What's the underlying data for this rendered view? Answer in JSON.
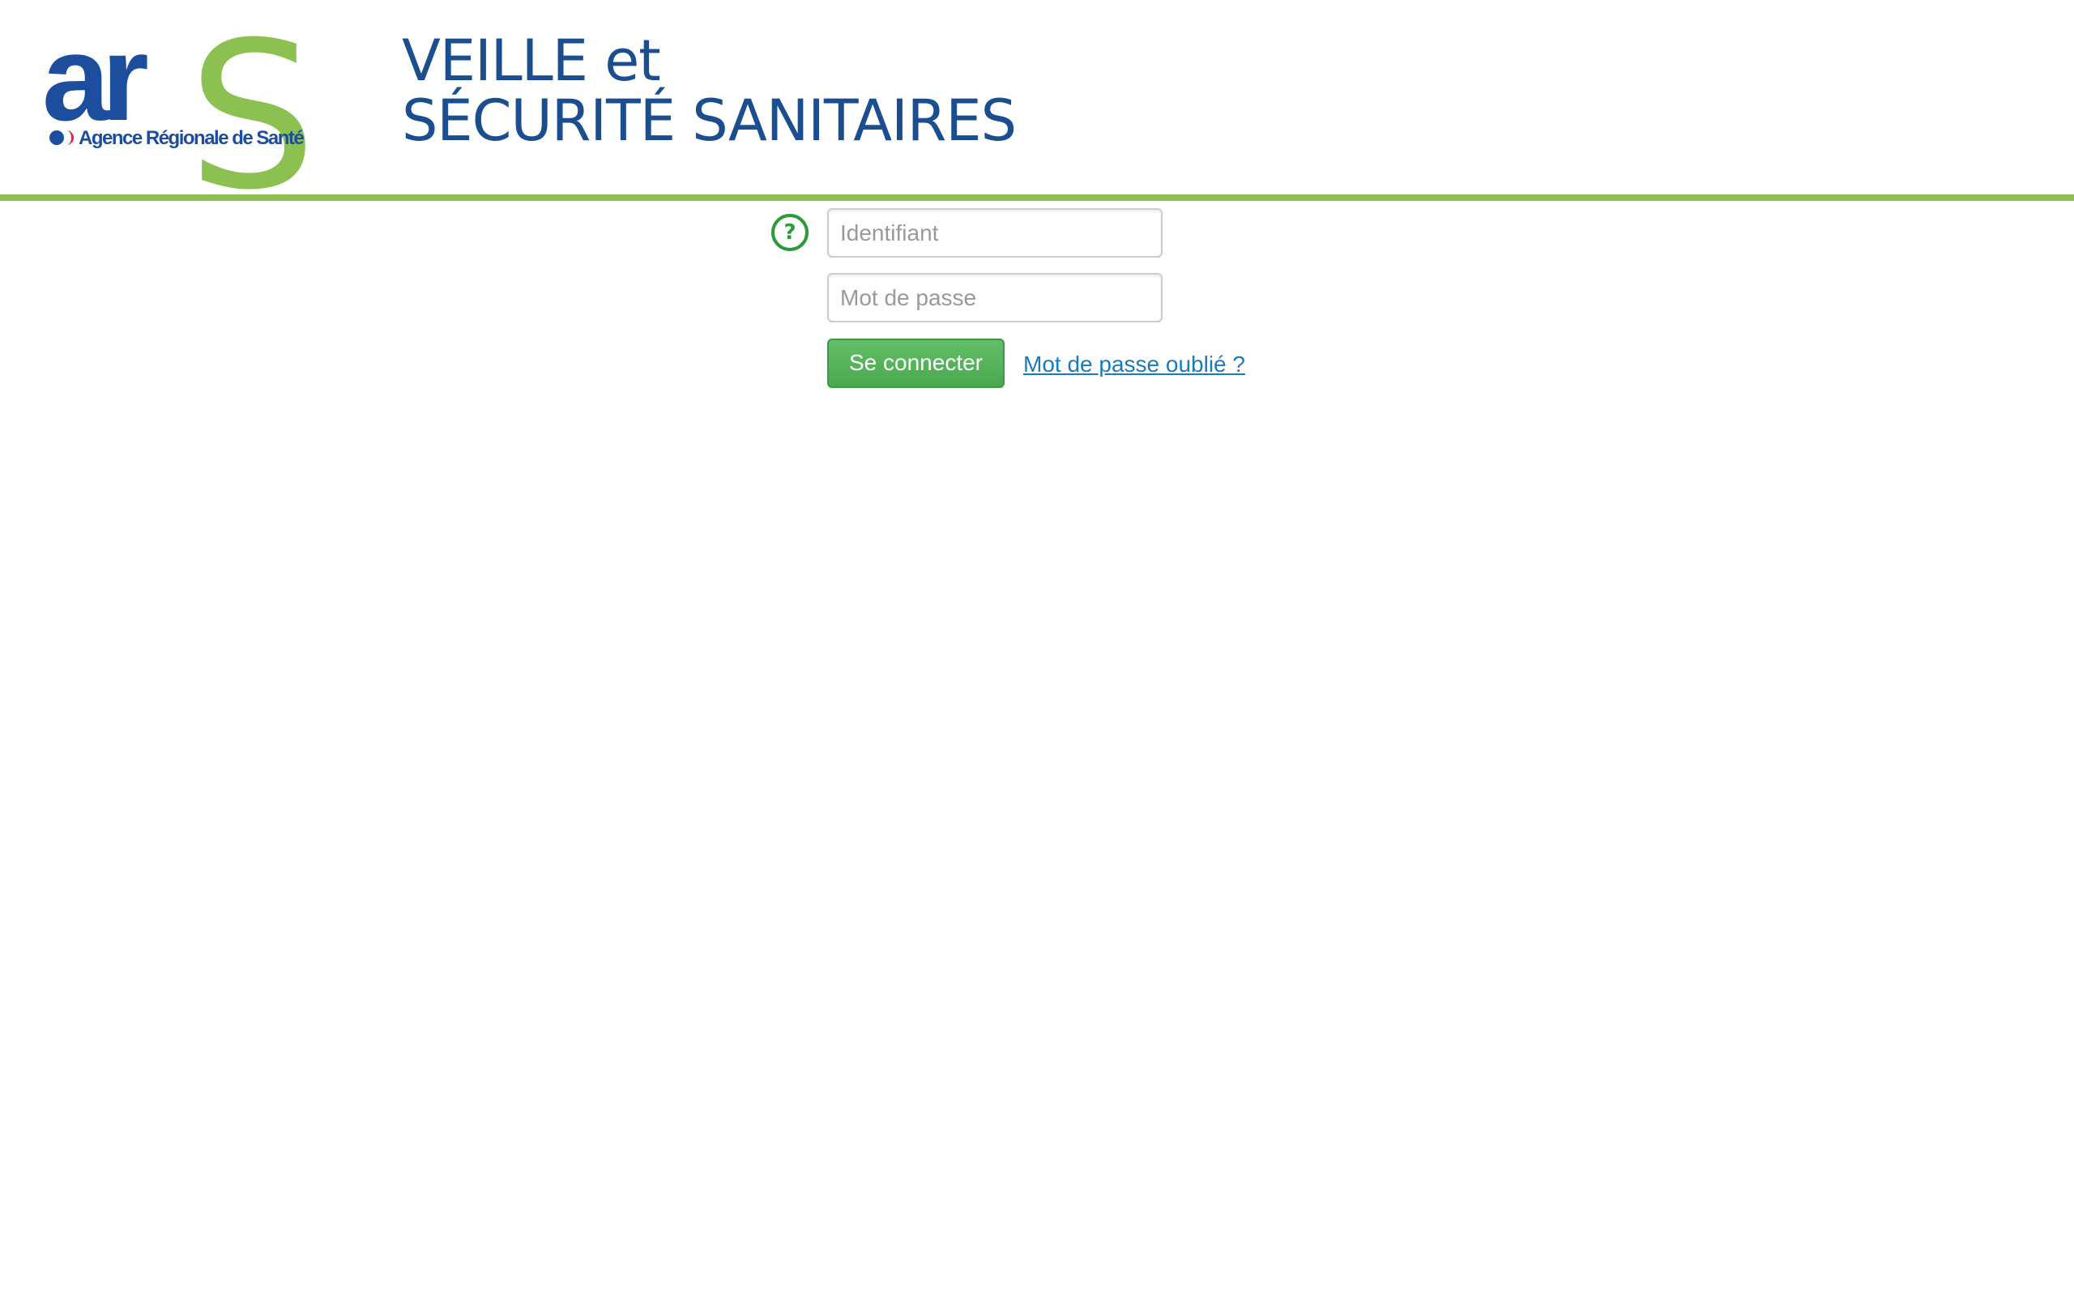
{
  "header": {
    "logo": {
      "wordmark": "ar",
      "letter_s": "S",
      "tagline": "Agence Régionale de Santé",
      "blue": "#1d4e9e",
      "green": "#8cc152",
      "dot_blue": "#1d4e9e",
      "dot_red": "#e4243a"
    },
    "title_line1": "VEILLE et",
    "title_line2": "SÉCURITÉ SANITAIRES"
  },
  "login": {
    "help_icon": "question-circle-icon",
    "help_symbol": "?",
    "username_placeholder": "Identifiant",
    "password_placeholder": "Mot de passe",
    "submit_label": "Se connecter",
    "forgot_link": "Mot de passe oublié ?"
  },
  "colors": {
    "title": "#1b4e8f",
    "accent_rule": "#8cc152",
    "help_icon": "#2d9a3a",
    "button": "#52ad56",
    "link": "#1a7bb8"
  }
}
